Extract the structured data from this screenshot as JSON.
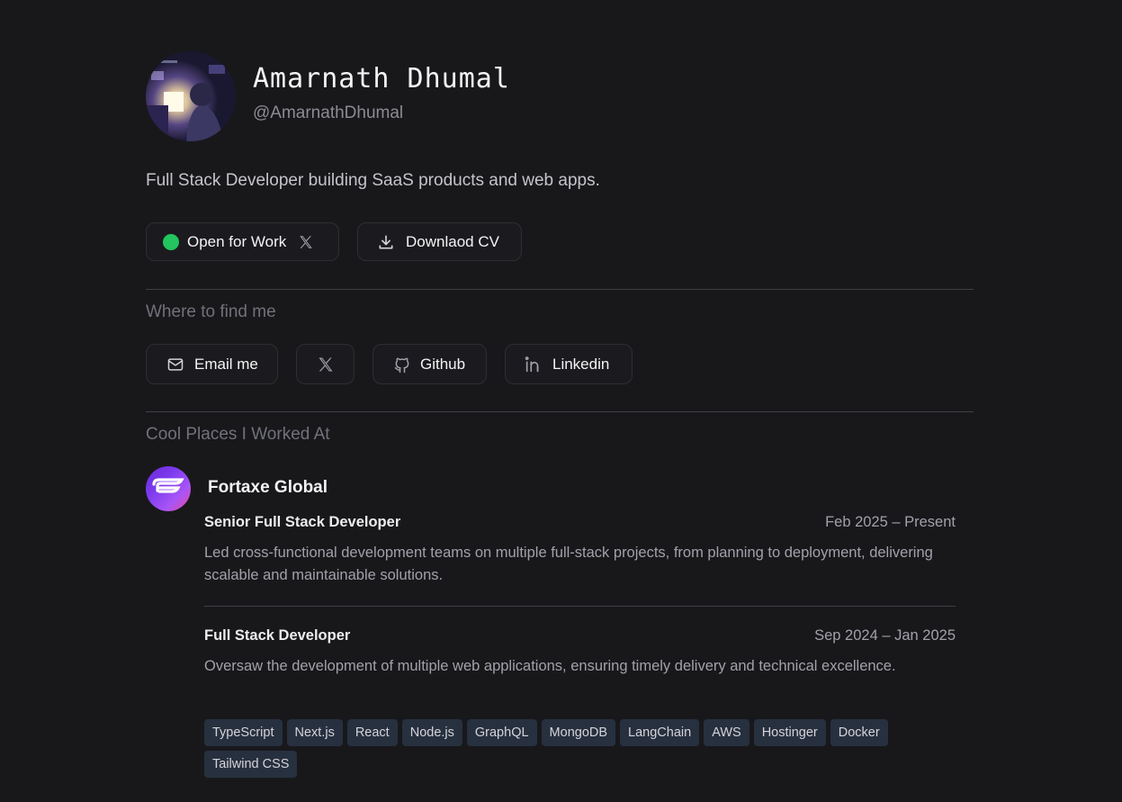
{
  "profile": {
    "name": "Amarnath Dhumal",
    "handle": "@AmarnathDhumal",
    "bio": "Full Stack Developer building SaaS products and web apps."
  },
  "actions": {
    "open_for_work": "Open for Work",
    "download_cv": "Downlaod CV"
  },
  "contact": {
    "title": "Where to find me",
    "email": "Email me",
    "github": "Github",
    "linkedin": "Linkedin"
  },
  "experience": {
    "title": "Cool Places I Worked At",
    "company": "Fortaxe Global",
    "roles": [
      {
        "title": "Senior Full Stack Developer",
        "dates": "Feb 2025 – Present",
        "description": "Led cross-functional development teams on multiple full-stack projects, from planning to deployment, delivering scalable and maintainable solutions."
      },
      {
        "title": "Full Stack Developer",
        "dates": "Sep 2024 – Jan 2025",
        "description": "Oversaw the development of multiple web applications, ensuring timely delivery and technical excellence."
      }
    ],
    "tags": [
      "TypeScript",
      "Next.js",
      "React",
      "Node.js",
      "GraphQL",
      "MongoDB",
      "LangChain",
      "AWS",
      "Hostinger",
      "Docker",
      "Tailwind CSS"
    ]
  },
  "colors": {
    "background": "#18181b",
    "status_green": "#22c55e",
    "tag_bg": "#27303f"
  }
}
